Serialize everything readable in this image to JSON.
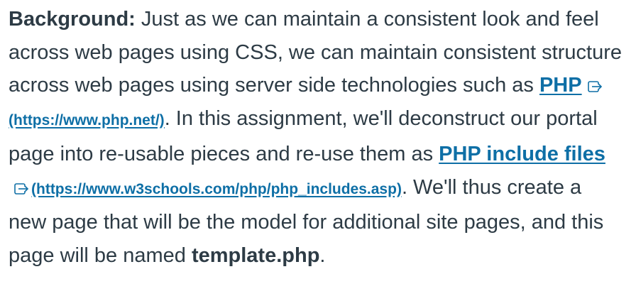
{
  "paragraph": {
    "lead": "Background:",
    "text1": " Just as we can maintain a consistent look and feel across web pages using CSS, we can maintain consistent structure across web pages using server side technologies such as ",
    "link1": {
      "label": "PHP",
      "url_text": "(https://www.php.net/)",
      "href": "https://www.php.net/"
    },
    "text2": ".  In this assignment, we'll deconstruct our portal page into re-usable pieces and re-use them as ",
    "link2": {
      "label": "PHP include files",
      "url_text": "(https://www.w3schools.com/php/php_includes.asp)",
      "href": "https://www.w3schools.com/php/php_includes.asp"
    },
    "text3": ". We'll thus create a new page that will be the model for additional site pages, and this page will be named ",
    "filename": "template.php",
    "text4": "."
  },
  "colors": {
    "text": "#2d3b45",
    "link": "#0e6fa6"
  },
  "icons": {
    "external_link": "external-link-icon"
  }
}
